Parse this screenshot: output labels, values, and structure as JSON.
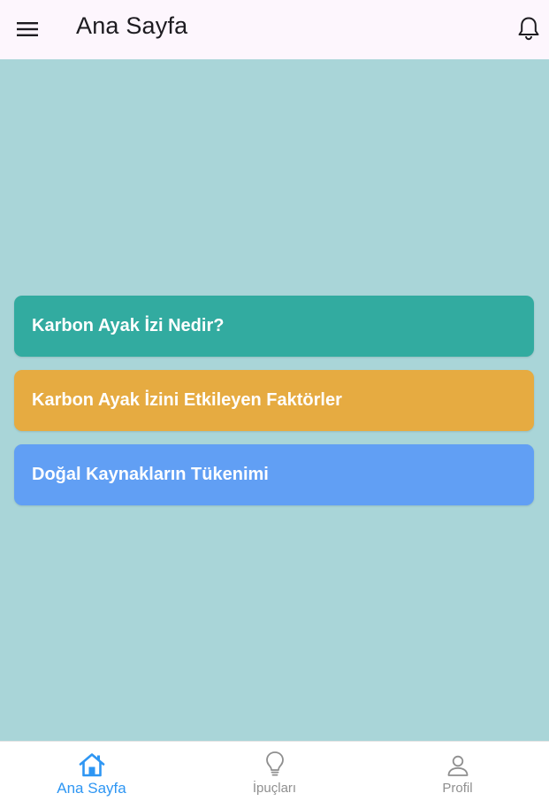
{
  "appbar": {
    "title": "Ana Sayfa",
    "menu_icon": "hamburger-menu-icon",
    "bell_icon": "bell-icon"
  },
  "cards": [
    {
      "label": "Karbon Ayak İzi Nedir?",
      "color": "#32aba0"
    },
    {
      "label": "Karbon Ayak İzini Etkileyen Faktörler",
      "color": "#e6ab41"
    },
    {
      "label": "Doğal Kaynakların Tükenimi",
      "color": "#619ff4"
    }
  ],
  "bottom_nav": {
    "items": [
      {
        "label": "Ana Sayfa",
        "icon": "home-icon",
        "active": true
      },
      {
        "label": "İpuçları",
        "icon": "lightbulb-icon",
        "active": false
      },
      {
        "label": "Profil",
        "icon": "person-icon",
        "active": false
      }
    ]
  },
  "colors": {
    "background": "#a9d5d8",
    "appbar": "#fdf6fd",
    "active_nav": "#2e96f3",
    "inactive_nav": "#8f8f8f"
  }
}
